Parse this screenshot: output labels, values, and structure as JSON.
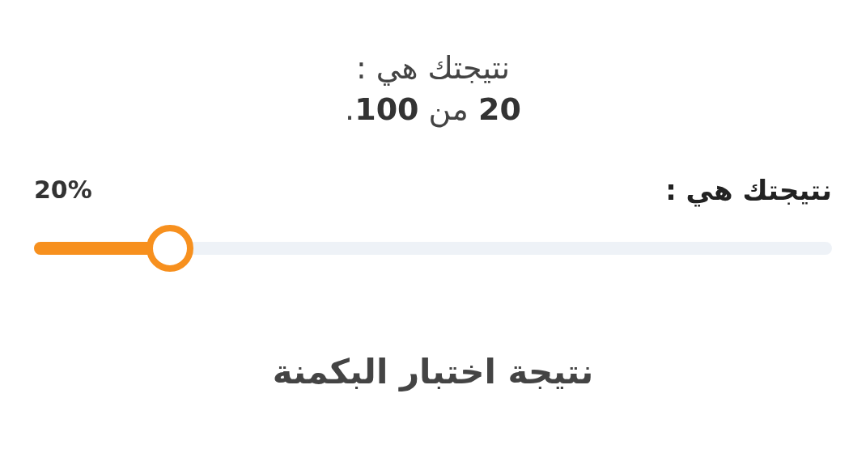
{
  "result_heading": "نتيجتك هي :",
  "result_score": "**20** من **100**.",
  "slider": {
    "label": "نتيجتك هي :",
    "reading": "20%",
    "level": 0.17
  },
  "test_title": "نتيجة اختبار البكمنة"
}
